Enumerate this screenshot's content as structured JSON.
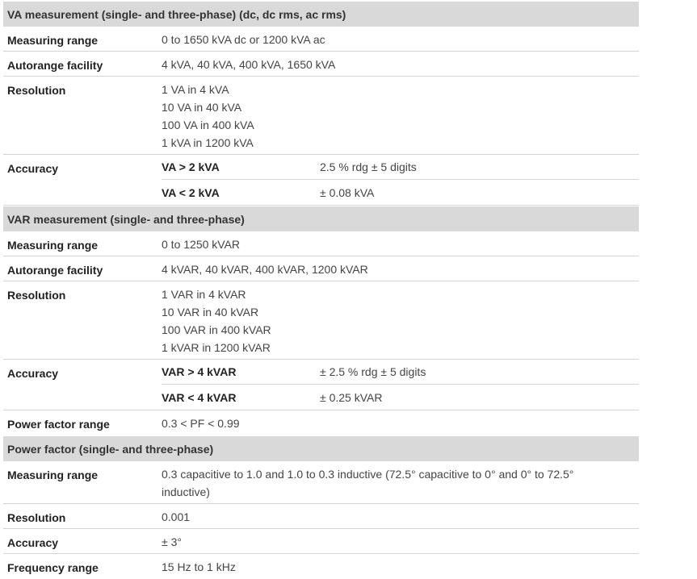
{
  "sections": [
    {
      "title": "VA measurement (single- and three-phase) (dc, dc rms, ac rms)",
      "measuring_range": {
        "label": "Measuring range",
        "value": "0 to 1650 kVA dc or 1200 kVA ac"
      },
      "autorange": {
        "label": "Autorange facility",
        "value": "4 kVA, 40 kVA, 400 kVA, 1650 kVA"
      },
      "resolution": {
        "label": "Resolution",
        "lines": [
          "1 VA in 4 kVA",
          "10 VA in 40 kVA",
          "100 VA in 400 kVA",
          "1 kVA in 1200 kVA"
        ]
      },
      "accuracy": {
        "label": "Accuracy",
        "rows": [
          {
            "condition": "VA > 2 kVA",
            "spec": "2.5 % rdg ± 5 digits"
          },
          {
            "condition": "VA < 2 kVA",
            "spec": "± 0.08 kVA"
          }
        ]
      }
    },
    {
      "title": "VAR measurement (single- and three-phase)",
      "measuring_range": {
        "label": "Measuring range",
        "value": "0 to 1250 kVAR"
      },
      "autorange": {
        "label": "Autorange facility",
        "value": "4 kVAR, 40 kVAR, 400 kVAR, 1200 kVAR"
      },
      "resolution": {
        "label": "Resolution",
        "lines": [
          "1 VAR in 4 kVAR",
          "10 VAR in 40 kVAR",
          "100 VAR in 400 kVAR",
          "1 kVAR in 1200 kVAR"
        ]
      },
      "accuracy": {
        "label": "Accuracy",
        "rows": [
          {
            "condition": "VAR > 4 kVAR",
            "spec": "± 2.5 % rdg ± 5 digits"
          },
          {
            "condition": "VAR < 4 kVAR",
            "spec": "± 0.25 kVAR"
          }
        ]
      },
      "power_factor_range": {
        "label": "Power factor range",
        "value": "0.3 < PF < 0.99"
      }
    },
    {
      "title": "Power factor (single- and three-phase)",
      "measuring_range": {
        "label": "Measuring range",
        "lines": [
          "0.3 capacitive to 1.0 and 1.0 to 0.3 inductive (72.5° capacitive to 0° and 0° to 72.5°",
          "inductive)"
        ]
      },
      "resolution": {
        "label": "Resolution",
        "value": "0.001"
      },
      "accuracy": {
        "label": "Accuracy",
        "value": "± 3°"
      },
      "frequency_range": {
        "label": "Frequency range",
        "value": "15 Hz to 1 kHz"
      }
    }
  ]
}
